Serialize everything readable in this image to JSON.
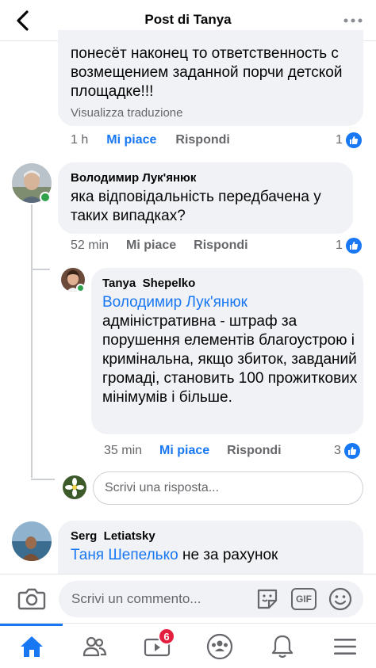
{
  "header": {
    "title": "Post di Tanya",
    "back_icon": "back-arrow-icon",
    "more_icon": "more-dots-icon"
  },
  "comments": [
    {
      "text": "понесёт наконец то ответственность с возмещением заданной порчи детской площадке!!!",
      "translate_label": "Visualizza traduzione",
      "time": "1 h",
      "like_label": "Mi piace",
      "reply_label": "Rispondi",
      "like_count": "1",
      "liked": true
    },
    {
      "author": "Володимир Лук'янюк",
      "text": "яка відповідальність передбачена у таких випадках?",
      "time": "52 min",
      "like_label": "Mi piace",
      "reply_label": "Rispondi",
      "like_count": "1",
      "liked": false
    },
    {
      "author": "Tanya  Shepelko",
      "mention": "Володимир Лук'янюк",
      "text": "адміністративна - штраф за порушення елементів благоустрою і кримінальна, якщо збиток, завданий громаді, становить 100 прожиткових мінімумів і більше.",
      "time": "35 min",
      "like_label": "Mi piace",
      "reply_label": "Rispondi",
      "like_count": "3",
      "liked": true
    },
    {
      "author": "Serg  Letiatsky",
      "mention": "Таня Шепелько",
      "text": "не за рахунок"
    }
  ],
  "reply_input": {
    "placeholder": "Scrivi una risposta..."
  },
  "composer": {
    "placeholder": "Scrivi un commento...",
    "camera_icon": "camera-icon",
    "sticker_icon": "sticker-icon",
    "gif_label": "GIF",
    "emoji_icon": "emoji-icon"
  },
  "tabbar": {
    "tabs": [
      "home-icon",
      "friends-icon",
      "watch-icon",
      "groups-icon",
      "notifications-icon",
      "menu-icon"
    ],
    "watch_badge": "6"
  },
  "colors": {
    "accent": "#1877f2",
    "bubble": "#f0f2f5",
    "online": "#31a24c",
    "badge": "#e41e3f"
  }
}
